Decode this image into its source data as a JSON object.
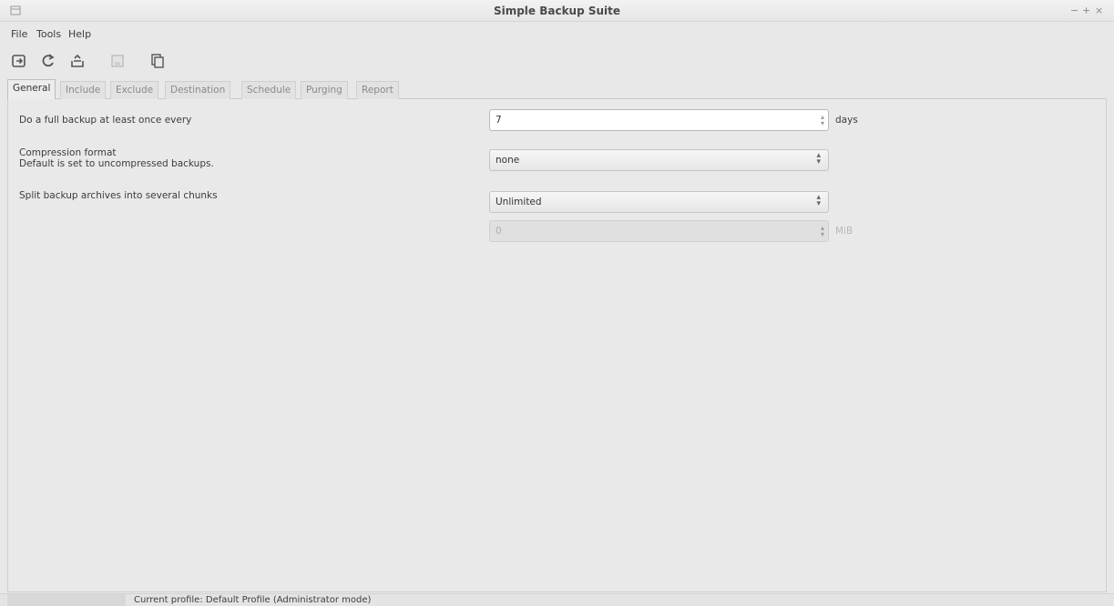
{
  "window": {
    "title": "Simple Backup Suite",
    "controls": [
      "−",
      "+",
      "×"
    ]
  },
  "menu": [
    "File",
    "Tools",
    "Help"
  ],
  "toolbar": {
    "buttons": [
      {
        "name": "backup-now-icon"
      },
      {
        "name": "refresh-icon"
      },
      {
        "name": "restore-icon"
      },
      {
        "name": "save-icon",
        "disabled": true
      },
      {
        "name": "copy-icon"
      }
    ]
  },
  "tabs": [
    "General",
    "Include",
    "Exclude",
    "Destination",
    "Schedule",
    "Purging",
    "Report"
  ],
  "active_tab": "General",
  "general": {
    "full_backup_label": "Do a full backup at least once every",
    "full_backup_value": "7",
    "full_backup_unit": "days",
    "compression_label": "Compression format",
    "compression_sublabel": "Default is set to uncompressed backups.",
    "compression_value": "none",
    "split_label": "Split backup archives into several chunks",
    "split_value": "Unlimited",
    "chunk_size_value": "0",
    "chunk_size_unit": "MiB"
  },
  "status": {
    "text": "Current profile: Default Profile  (Administrator mode)"
  },
  "colors": {
    "window_bg": "#e8e8e8",
    "input_bg": "#ffffff",
    "disabled_bg": "#e0e0e0"
  }
}
